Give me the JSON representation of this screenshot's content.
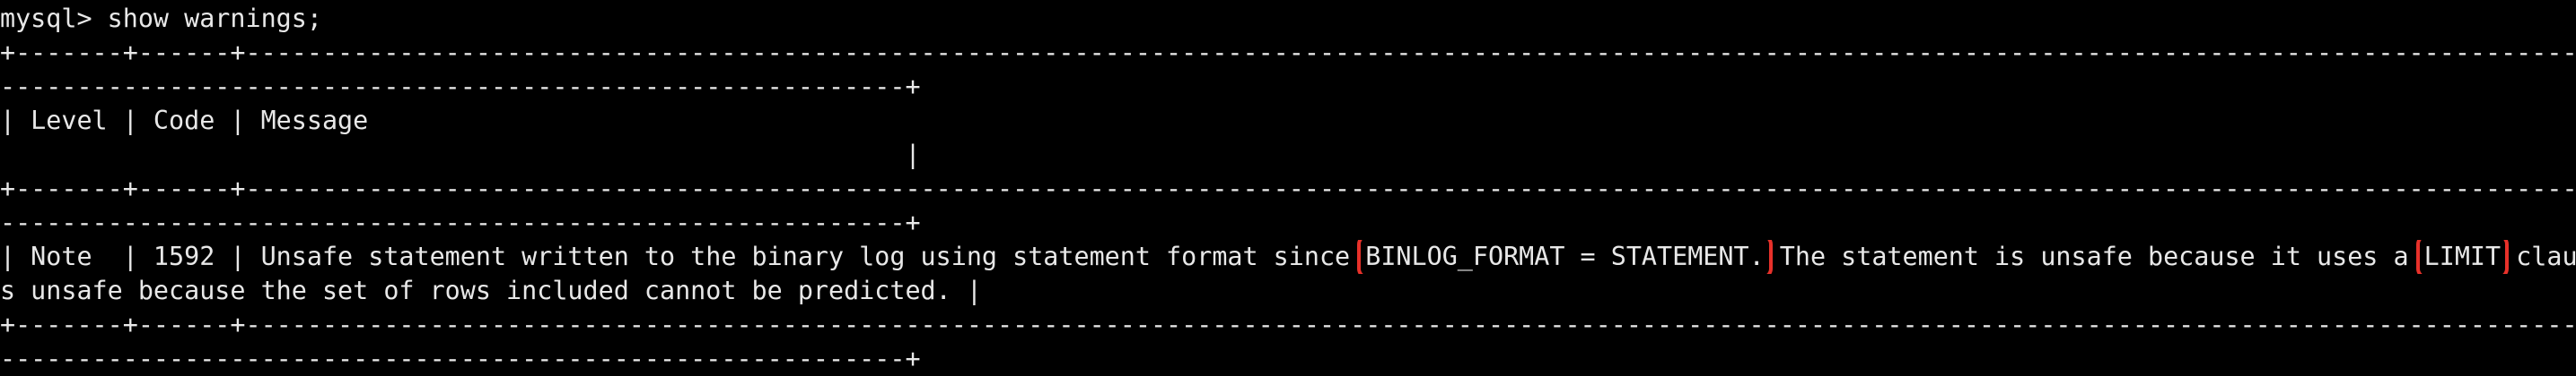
{
  "terminal": {
    "lines": [
      "mysql> show warnings;",
      "+-------+------+-----------------------------------------------------------------------------------------------------------------------------------------------------------------------------------------",
      "-----------------------------------------------------------+",
      "| Level | Code | Message",
      "                                                           |",
      "+-------+------+-----------------------------------------------------------------------------------------------------------------------------------------------------------------------------------------",
      "-----------------------------------------------------------+",
      "",
      "s unsafe because the set of rows included cannot be predicted. |",
      "+-------+------+-----------------------------------------------------------------------------------------------------------------------------------------------------------------------------------------",
      "-----------------------------------------------------------+"
    ],
    "warning_row": {
      "part1": "| Note  | 1592 | Unsafe statement written to the binary log using statement format since ",
      "highlight1": "BINLOG_FORMAT = STATEMENT.",
      "part2": " The statement is unsafe because it uses a ",
      "highlight2": "LIMIT",
      "part3": " clause. This i"
    },
    "highlight_color": "#e8312a"
  }
}
